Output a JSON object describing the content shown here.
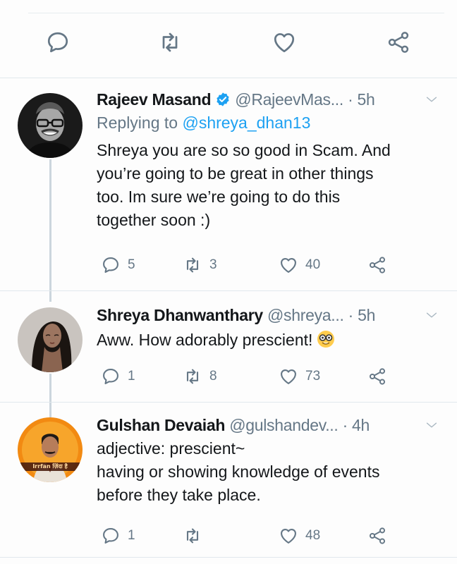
{
  "tweets": [
    {
      "name": "Rajeev Masand",
      "verified": true,
      "handle": "@RajeevMas...",
      "dot": "·",
      "time": "5h",
      "replying_label": "Replying to",
      "replying_to": "@shreya_dhan13",
      "lines": [
        "Shreya you are so so good in Scam. And",
        "you’re going to be great in other things",
        "too. Im sure we’re going to do this",
        "together soon :)"
      ],
      "replies": "5",
      "retweets": "3",
      "likes": "40"
    },
    {
      "name": "Shreya Dhanwanthary",
      "handle": "@shreya...",
      "dot": "·",
      "time": "5h",
      "lines": [
        "Aww. How adorably prescient!"
      ],
      "emoji_icon": "nerd-face-emoji-icon",
      "replies": "1",
      "retweets": "8",
      "likes": "73"
    },
    {
      "name": "Gulshan Devaiah",
      "handle": "@gulshandev...",
      "dot": "·",
      "time": "4h",
      "lines": [
        "adjective: prescient~",
        "having or showing knowledge of events",
        "before they take place."
      ],
      "replies": "1",
      "retweets": "",
      "likes": "48",
      "avatar_caption": "Irrfan ज़िंदा है"
    }
  ],
  "colors": {
    "icon_gray": "#657786",
    "link_blue": "#1da1f2",
    "verified_blue": "#1da1f2",
    "thread_line": "#ccd6dd"
  },
  "icons": [
    "reply-icon",
    "retweet-icon",
    "like-icon",
    "share-icon",
    "verified-badge-icon",
    "chevron-down-icon"
  ]
}
